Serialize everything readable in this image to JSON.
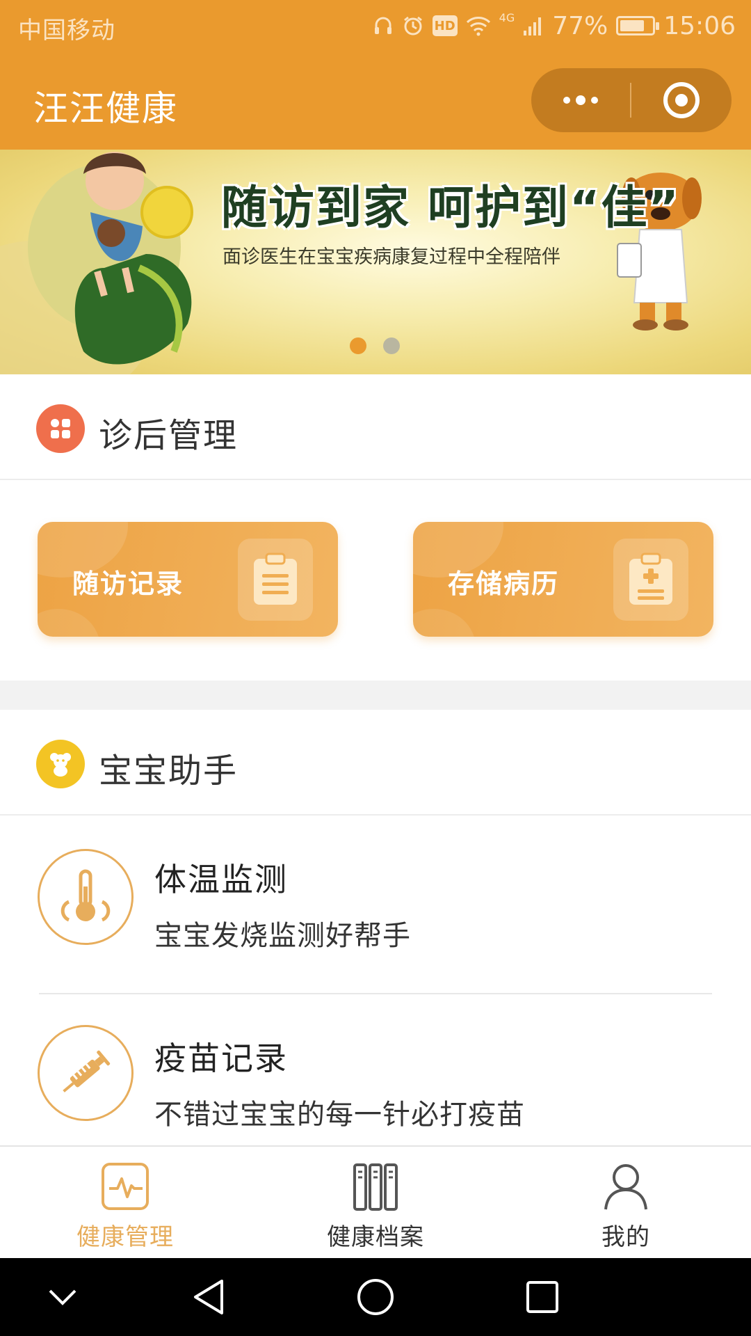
{
  "status_bar": {
    "carrier": "中国移动",
    "network": "4G",
    "battery_percent": "77%",
    "battery_level": 0.77,
    "time": "15:06",
    "icons": [
      "headphones-icon",
      "alarm-icon",
      "hd-icon",
      "wifi-icon",
      "signal-icon",
      "battery-icon"
    ]
  },
  "title_bar": {
    "title": "汪汪健康",
    "more_icon": "more-dots-icon",
    "close_icon": "target-icon"
  },
  "banner": {
    "headline": "随访到家  呵护到“佳”",
    "subtitle": "面诊医生在宝宝疾病康复过程中全程陪伴",
    "active_slide": 1,
    "slides": 2
  },
  "section_post": {
    "title": "诊后管理",
    "icon": "grid-icon",
    "icon_color": "#ef6f4c"
  },
  "cards": [
    {
      "label": "随访记录",
      "icon": "clipboard-icon"
    },
    {
      "label": "存储病历",
      "icon": "medical-record-icon"
    }
  ],
  "section_baby": {
    "title": "宝宝助手",
    "icon": "teddy-bear-icon",
    "icon_color": "#f3c424"
  },
  "list": [
    {
      "title": "体温监测",
      "desc": "宝宝发烧监测好帮手",
      "icon": "thermometer-icon"
    },
    {
      "title": "疫苗记录",
      "desc": "不错过宝宝的每一针必打疫苗",
      "icon": "syringe-icon"
    }
  ],
  "tabs": [
    {
      "label": "健康管理",
      "icon": "pulse-icon",
      "active": true
    },
    {
      "label": "健康档案",
      "icon": "folders-icon",
      "active": false
    },
    {
      "label": "我的",
      "icon": "person-icon",
      "active": false
    }
  ],
  "colors": {
    "brand": "#ea9a2e",
    "accent_text": "#e7ad5c"
  }
}
